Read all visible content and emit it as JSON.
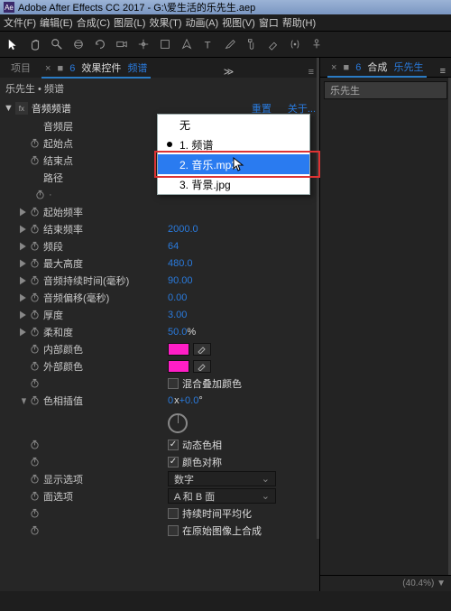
{
  "titlebar": {
    "text": "Adobe After Effects CC 2017 - G:\\爱生活的乐先生.aep"
  },
  "menubar": [
    "文件(F)",
    "编辑(E)",
    "合成(C)",
    "图层(L)",
    "效果(T)",
    "动画(A)",
    "视图(V)",
    "窗口",
    "帮助(H)"
  ],
  "leftTabs": {
    "project": "项目",
    "effectControls": "效果控件",
    "effectTarget": "频谱"
  },
  "rightTabs": {
    "comp": "合成",
    "compName": "乐先生"
  },
  "rightLayer": {
    "name": "乐先生"
  },
  "crumb": "乐先生 • 频谱",
  "fx": {
    "name": "音频频谱",
    "reset": "重置",
    "about": "关于..."
  },
  "rows": {
    "audioLayer": {
      "label": "音频层",
      "selected": "1. 频谱"
    },
    "startPoint": "起始点",
    "endPoint": "结束点",
    "path": "路径",
    "startFreq": {
      "label": "起始频率"
    },
    "endFreq": {
      "label": "结束频率",
      "val": "2000.0"
    },
    "bands": {
      "label": "频段",
      "val": "64"
    },
    "maxHeight": {
      "label": "最大高度",
      "val": "480.0"
    },
    "audioDur": {
      "label": "音频持续时间(毫秒)",
      "val": "90.00"
    },
    "audioOff": {
      "label": "音频偏移(毫秒)",
      "val": "0.00"
    },
    "thickness": {
      "label": "厚度",
      "val": "3.00"
    },
    "softness": {
      "label": "柔和度",
      "val": "50.0",
      "suffix": "%"
    },
    "innerColor": {
      "label": "内部颜色",
      "hex": "#ff1ec6"
    },
    "outerColor": {
      "label": "外部颜色",
      "hex": "#ff1ec6"
    },
    "blendColors": "混合叠加颜色",
    "hueInterp": {
      "label": "色相插值",
      "val": "0",
      "suffix": "x+0.0°"
    },
    "dynHue": "动态色相",
    "colorSym": "颜色对称",
    "display": {
      "label": "显示选项",
      "selected": "数字"
    },
    "side": {
      "label": "面选项",
      "selected": "A 和 B 面"
    },
    "durAvg": "持续时间平均化",
    "origComp": "在原始图像上合成"
  },
  "popup": {
    "options": [
      "无",
      "1. 频谱",
      "2. 音乐.mp3",
      "3. 背景.jpg"
    ],
    "current": 1,
    "hover": 2
  },
  "zoomStub": "(40.4%)"
}
